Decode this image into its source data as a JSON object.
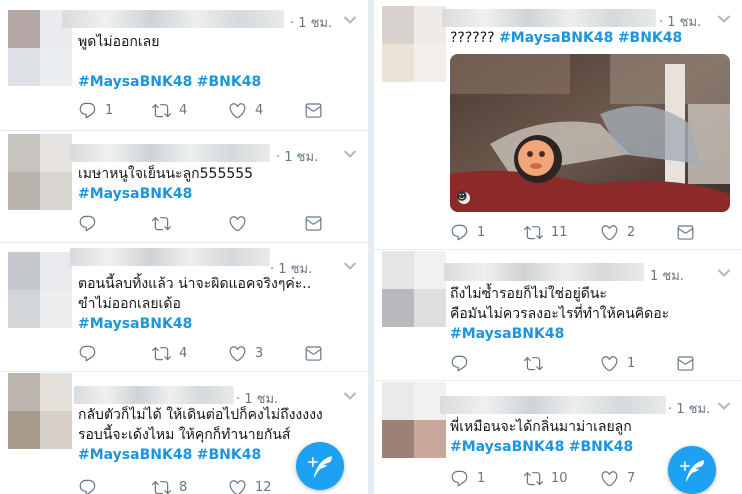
{
  "icons": {
    "reply": "reply-icon",
    "retweet": "retweet-icon",
    "like": "heart-icon",
    "dm": "message-icon",
    "compose": "compose-tweet-icon",
    "more": "chevron-down-icon"
  },
  "colors": {
    "accent": "#1b95e0",
    "fab": "#1da1f2",
    "muted": "#657786"
  },
  "left_column": {
    "tweets": [
      {
        "time": "· 1 ชม.",
        "line1": "พูดไม่ออกเลย",
        "line2": "",
        "tags": [
          "#MaysaBNK48",
          "#BNK48"
        ],
        "reply": "1",
        "retweet": "4",
        "like": "4"
      },
      {
        "time": "· 1 ชม.",
        "line1": "เมษาหนูใจเย็นนะลูก555555",
        "line2": "",
        "tags": [
          "#MaysaBNK48"
        ],
        "reply": "",
        "retweet": "",
        "like": ""
      },
      {
        "time": "· 1 ชม.",
        "line1": "ตอนนี้ลบทิ้งแล้ว น่าจะผิดแอคจริงๆค่ะ..",
        "line2": "ขำไม่ออกเลยเด้อ",
        "tags": [
          "#MaysaBNK48"
        ],
        "reply": "",
        "retweet": "4",
        "like": "3"
      },
      {
        "time": "· 1 ชม.",
        "line1": "กลับตัวก็ไม่ได้ ให้เดินต่อไปก็คงไม่ถึงงงงง",
        "line2": "รอบนี้จะเด้งไหม ให้คุกก็ทำนายกันส์",
        "tags": [
          "#MaysaBNK48",
          "#BNK48"
        ],
        "reply": "",
        "retweet": "8",
        "like": "12"
      }
    ]
  },
  "right_column": {
    "tweets": [
      {
        "time": "· 1 ชม.",
        "line1": "??????",
        "tags": [
          "#MaysaBNK48",
          "#BNK48"
        ],
        "reply": "1",
        "retweet": "11",
        "like": "2",
        "media_badge": "☻"
      },
      {
        "time": "1 ชม.",
        "line1": "ถึงไม่ซ้ำรอยก็ไม่ใช่อยู่ดีนะ",
        "line2": "คือมันไม่ควรลงอะไรที่ทำให้คนคิดอะ",
        "tags": [
          "#MaysaBNK48"
        ],
        "reply": "",
        "retweet": "",
        "like": "1"
      },
      {
        "time": "· 1 ชม.",
        "line1": "พี่เหมือนจะได้กลิ่นมาม่าเลยลูก",
        "tags": [
          "#MaysaBNK48",
          "#BNK48"
        ],
        "reply": "1",
        "retweet": "10",
        "like": "7"
      }
    ]
  }
}
